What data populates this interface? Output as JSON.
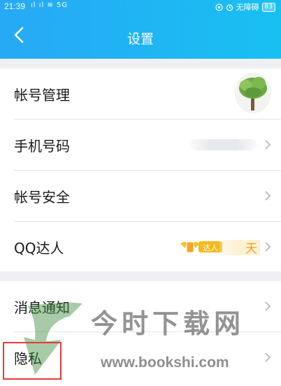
{
  "status_bar": {
    "time": "21:39",
    "signal": "ıl ıl ≋ 5G",
    "accessibility": "无障碍",
    "battery": "83"
  },
  "header": {
    "title": "设置"
  },
  "settings": {
    "group1": [
      {
        "label": "帐号管理"
      },
      {
        "label": "手机号码"
      },
      {
        "label": "帐号安全"
      },
      {
        "label": "QQ达人",
        "badge": "达人",
        "days_unit": "天"
      }
    ],
    "group2": [
      {
        "label": "消息通知"
      },
      {
        "label": "隐私"
      }
    ]
  },
  "watermark": {
    "chinese": "今时下载网",
    "url": "www.bookshi.com"
  },
  "colors": {
    "header_start": "#27a9f5",
    "header_end": "#18c0f2",
    "highlight": "#e83a3a",
    "badge": "#f5b91e"
  }
}
